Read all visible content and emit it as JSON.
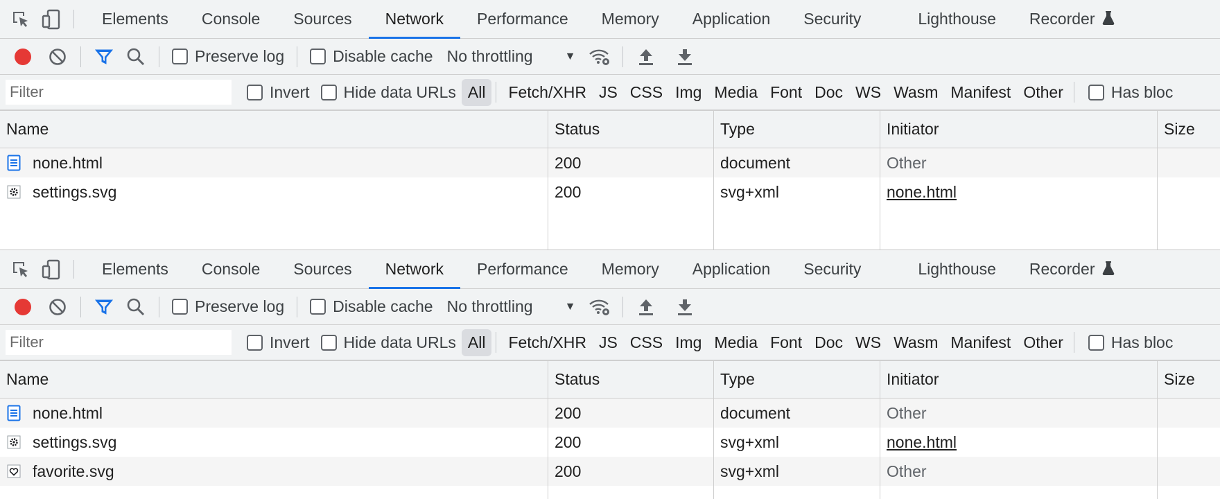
{
  "panels": [
    {
      "tabs": [
        "Elements",
        "Console",
        "Sources",
        "Network",
        "Performance",
        "Memory",
        "Application",
        "Security",
        "Lighthouse",
        "Recorder"
      ],
      "active_tab": "Network",
      "toolbar": {
        "preserve_log": "Preserve log",
        "disable_cache": "Disable cache",
        "throttling": "No throttling"
      },
      "filter": {
        "placeholder": "Filter",
        "invert": "Invert",
        "hide_data_urls": "Hide data URLs",
        "types": [
          "All",
          "Fetch/XHR",
          "JS",
          "CSS",
          "Img",
          "Media",
          "Font",
          "Doc",
          "WS",
          "Wasm",
          "Manifest",
          "Other"
        ],
        "has_blocked": "Has bloc"
      },
      "table": {
        "columns": [
          "Name",
          "Status",
          "Type",
          "Initiator",
          "Size"
        ],
        "rows": [
          {
            "icon": "document-icon",
            "name": "none.html",
            "status": "200",
            "type": "document",
            "initiator": "Other",
            "initiator_link": false
          },
          {
            "icon": "settings-icon",
            "name": "settings.svg",
            "status": "200",
            "type": "svg+xml",
            "initiator": "none.html",
            "initiator_link": true
          }
        ]
      }
    },
    {
      "tabs": [
        "Elements",
        "Console",
        "Sources",
        "Network",
        "Performance",
        "Memory",
        "Application",
        "Security",
        "Lighthouse",
        "Recorder"
      ],
      "active_tab": "Network",
      "toolbar": {
        "preserve_log": "Preserve log",
        "disable_cache": "Disable cache",
        "throttling": "No throttling"
      },
      "filter": {
        "placeholder": "Filter",
        "invert": "Invert",
        "hide_data_urls": "Hide data URLs",
        "types": [
          "All",
          "Fetch/XHR",
          "JS",
          "CSS",
          "Img",
          "Media",
          "Font",
          "Doc",
          "WS",
          "Wasm",
          "Manifest",
          "Other"
        ],
        "has_blocked": "Has bloc"
      },
      "table": {
        "columns": [
          "Name",
          "Status",
          "Type",
          "Initiator",
          "Size"
        ],
        "rows": [
          {
            "icon": "document-icon",
            "name": "none.html",
            "status": "200",
            "type": "document",
            "initiator": "Other",
            "initiator_link": false
          },
          {
            "icon": "settings-icon",
            "name": "settings.svg",
            "status": "200",
            "type": "svg+xml",
            "initiator": "none.html",
            "initiator_link": true
          },
          {
            "icon": "heart-icon",
            "name": "favorite.svg",
            "status": "200",
            "type": "svg+xml",
            "initiator": "Other",
            "initiator_link": false
          }
        ]
      }
    }
  ],
  "colors": {
    "record": "#e53935",
    "filter_active": "#1a73e8",
    "tab_underline": "#1a73e8"
  }
}
